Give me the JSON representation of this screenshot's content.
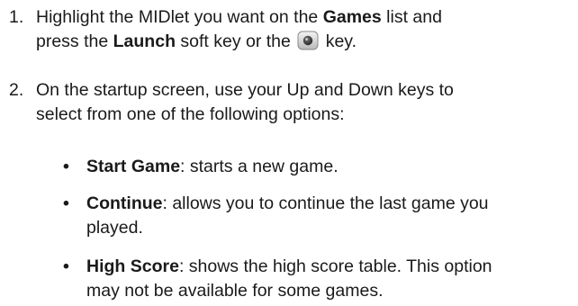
{
  "steps": [
    {
      "number": "1.",
      "line1_pre": "Highlight the MIDlet you want on the ",
      "line1_bold": "Games",
      "line1_post": " list and",
      "line2_pre": "press the ",
      "line2_bold": "Launch",
      "line2_mid": " soft key or the ",
      "line2_post": " key.",
      "key_icon": "center-select-key-icon"
    },
    {
      "number": "2.",
      "line1": "On the startup screen, use your Up and Down keys to",
      "line2": "select from one of the following options:"
    }
  ],
  "options": [
    {
      "bullet": "•",
      "term": "Start Game",
      "line1": ": starts a new game."
    },
    {
      "bullet": "•",
      "term": "Continue",
      "line1": ": allows you to continue the last game you",
      "line2": "played."
    },
    {
      "bullet": "•",
      "term": "High Score",
      "line1": ": shows the high score table. This option",
      "line2": "may not be available for some games."
    }
  ]
}
